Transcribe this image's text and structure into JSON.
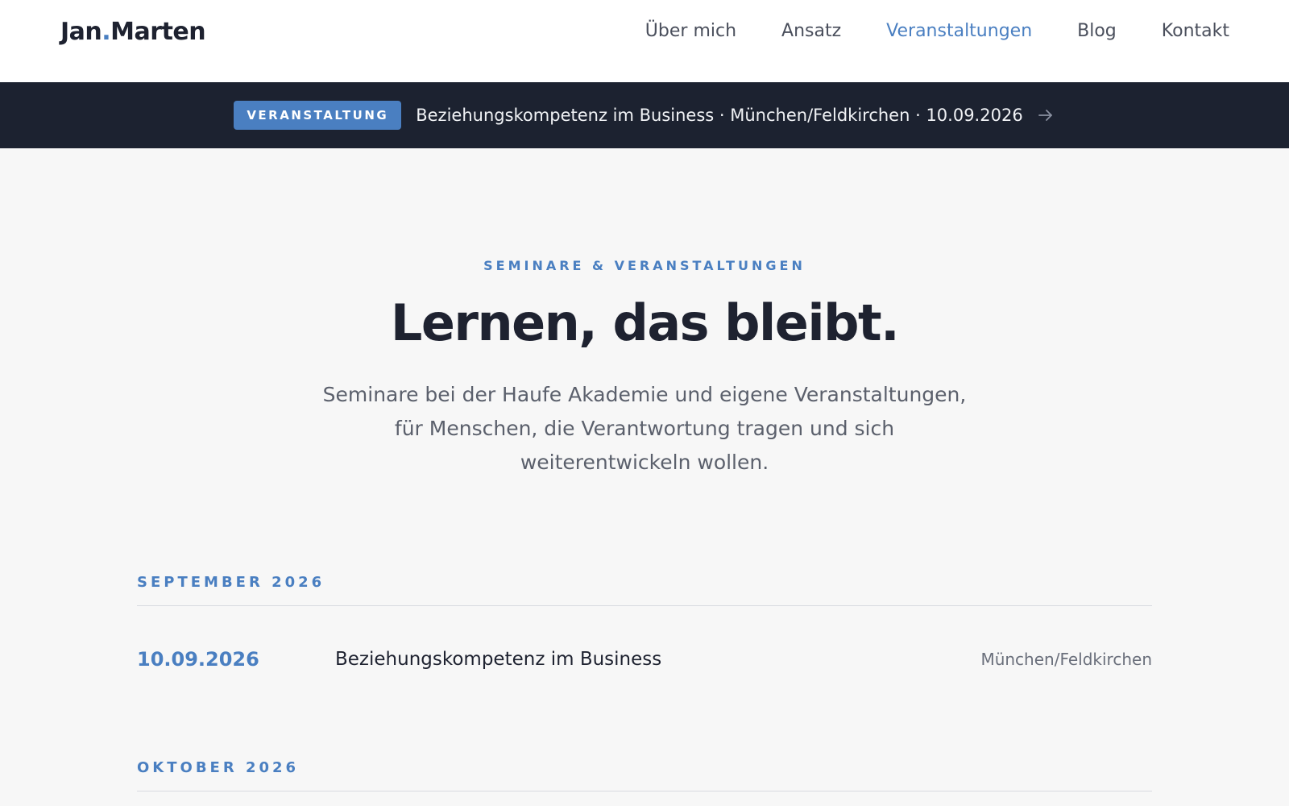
{
  "header": {
    "logo_first": "Jan",
    "logo_dot": ".",
    "logo_last": "Marten",
    "nav": [
      {
        "label": "Über mich"
      },
      {
        "label": "Ansatz"
      },
      {
        "label": "Veranstaltungen",
        "active": true
      },
      {
        "label": "Blog"
      },
      {
        "label": "Kontakt"
      }
    ]
  },
  "banner": {
    "badge": "VERANSTALTUNG",
    "text": "Beziehungskompetenz im Business · München/Feldkirchen · 10.09.2026",
    "arrow_icon": "arrow-right-icon"
  },
  "hero": {
    "eyebrow": "SEMINARE & VERANSTALTUNGEN",
    "title": "Lernen, das bleibt.",
    "lead": "Seminare bei der Haufe Akademie und eigene Veranstaltungen, für Menschen, die Verantwortung tragen und sich weiterentwickeln wollen."
  },
  "schedule": {
    "months": [
      {
        "label": "SEPTEMBER 2026",
        "events": [
          {
            "date": "10.09.2026",
            "title": "Beziehungskompetenz im Business",
            "location": "München/Feldkirchen"
          }
        ]
      },
      {
        "label": "OKTOBER 2026",
        "events": []
      }
    ]
  },
  "colors": {
    "accent": "#4a7fc1",
    "dark": "#1c2230",
    "background": "#f7f7f7",
    "text": "#1e2230",
    "muted": "#5b606c"
  }
}
